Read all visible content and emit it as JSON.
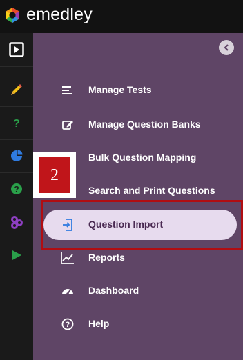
{
  "app": {
    "logo_text": "emedley"
  },
  "rail": {
    "items": [
      {
        "name": "panel-toggle-icon"
      },
      {
        "name": "pencil-icon"
      },
      {
        "name": "question-icon"
      },
      {
        "name": "pie-chart-icon"
      },
      {
        "name": "help-circle-icon"
      },
      {
        "name": "hexagons-icon"
      },
      {
        "name": "play-icon"
      }
    ]
  },
  "menu": {
    "items": [
      {
        "label": "Manage Tests",
        "icon": "list-icon"
      },
      {
        "label": "Manage Question Banks",
        "icon": "edit-icon"
      },
      {
        "label": "Bulk Question Mapping",
        "icon": "mapping-icon"
      },
      {
        "label": "Search and Print Questions",
        "icon": "search-print-icon"
      },
      {
        "label": "Question Import",
        "icon": "import-icon",
        "active": true
      },
      {
        "label": "Reports",
        "icon": "chart-line-icon"
      },
      {
        "label": "Dashboard",
        "icon": "dashboard-icon"
      },
      {
        "label": "Help",
        "icon": "help-icon"
      }
    ]
  },
  "annotation": {
    "step_number": "2"
  },
  "colors": {
    "panel_bg": "#5f4566",
    "active_bg": "#e7dbee",
    "highlight_border": "#b10d12",
    "badge_red": "#c0151a"
  }
}
